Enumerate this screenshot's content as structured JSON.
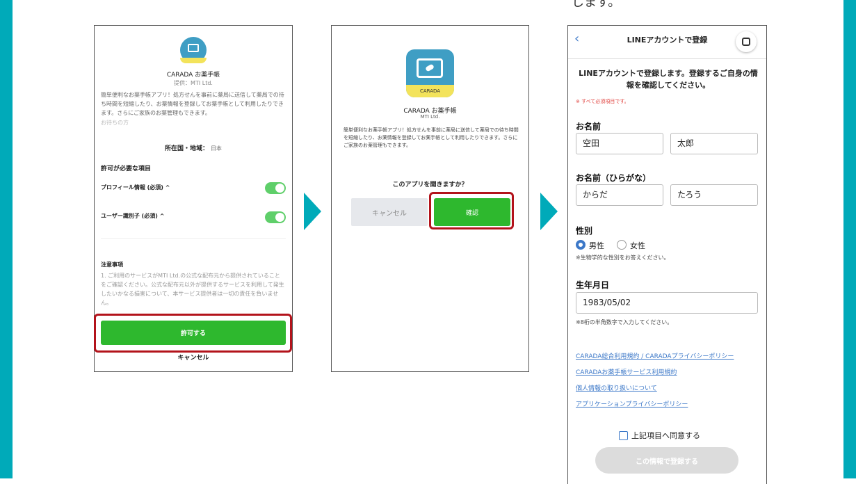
{
  "top_text": "します。",
  "screen1": {
    "app_name": "CARADA お薬手帳",
    "provider": "提供：MTI Ltd.",
    "description": "簡単便利なお薬手帳アプリ！処方せんを事前に薬局に送信して薬局での待ち時間を短縮したり、お薬情報を登録してお薬手帳として利用したりできます。さらにご家族のお薬管理もできます。",
    "description_cut": "お待ちの方",
    "region_label": "所在国・地域：",
    "region_value": "日本",
    "permissions_title": "許可が必要な項目",
    "perm_profile": "プロフィール情報 (必須) ^",
    "perm_userid": "ユーザー識別子 (必須) ^",
    "notes_title": "注意事項",
    "notes_text": "1. ご利用のサービスがMTI Ltd.の公式な配布元から提供されていることをご確認ください。公式な配布元以外が提供するサービスを利用して発生したいかなる損害について、本サービス提供者は一切の責任を負いません。",
    "allow_button": "許可する",
    "cancel_link": "キャンセル"
  },
  "screen2": {
    "icon_label": "CARADA",
    "app_name": "CARADA お薬手帳",
    "provider": "MTI Ltd.",
    "description": "簡単便利なお薬手帳アプリ！処方せんを事前に薬局に送信して薬局での待ち時間を短縮したり、お薬情報を登録してお薬手帳として利用したりできます。さらにご家族のお薬管理もできます。",
    "question": "このアプリを開きますか？",
    "cancel_button": "キャンセル",
    "confirm_button": "確認"
  },
  "screen3": {
    "header_title": "LINEアカウントで登録",
    "intro": "LINEアカウントで登録します。登録するご自身の情報を確認してください。",
    "required_note": "※ すべて必須項目です。",
    "name_label": "お名前",
    "last_name": "空田",
    "first_name": "太郎",
    "kana_label": "お名前（ひらがな）",
    "last_kana": "からだ",
    "first_kana": "たろう",
    "gender_label": "性別",
    "male": "男性",
    "female": "女性",
    "gender_note": "※生物学的な性別をお答えください。",
    "birth_label": "生年月日",
    "birth_value": "1983/05/02",
    "birth_note": "※8桁の半角数字で入力してください。",
    "links": [
      "CARADA総合利用規約 / CARADAプライバシーポリシー",
      "CARADAお薬手帳サービス利用規約",
      "個人情報の取り扱いについて",
      "アプリケーションプライバシーポリシー"
    ],
    "agree_label": "上記項目へ同意する",
    "submit_button": "この情報で登録する"
  },
  "colors": {
    "accent": "#00aab9",
    "green": "#2eb82e",
    "highlight": "#b3131b",
    "link": "#3c78c8"
  }
}
